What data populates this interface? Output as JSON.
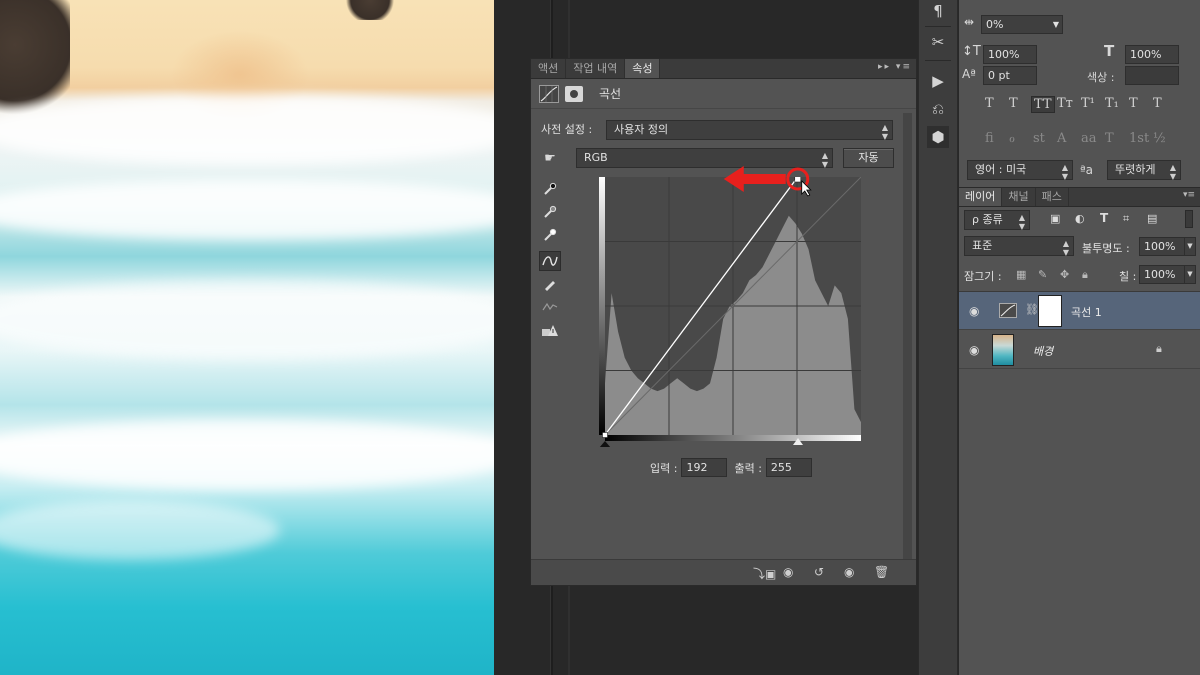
{
  "properties_panel": {
    "tabs": [
      "액션",
      "작업 내역",
      "속성"
    ],
    "active_tab": "속성",
    "tab_tools": "▸▸ ▾≡",
    "title": "곡선",
    "preset_label": "사전 설정 :",
    "preset_value": "사용자 정의",
    "channel_value": "RGB",
    "auto_button": "자동",
    "input_label": "입력 :",
    "input_value": "192",
    "output_label": "출력 :",
    "output_value": "255",
    "tool_icons": [
      "hand-adjust-icon",
      "eyedropper-black-icon",
      "eyedropper-gray-icon",
      "eyedropper-white-icon",
      "curve-point-icon",
      "pencil-icon",
      "smooth-icon",
      "clipping-warning-icon"
    ],
    "footer_icons": [
      "clip-to-layer-icon",
      "view-previous-icon",
      "reset-icon",
      "visibility-icon",
      "trash-icon"
    ],
    "curve": {
      "input_range": [
        0,
        255
      ],
      "output_range": [
        0,
        255
      ],
      "points": [
        [
          0,
          0
        ],
        [
          192,
          255
        ]
      ],
      "selected_point": [
        192,
        255
      ],
      "highlight_color": "#e8201d"
    }
  },
  "character_panel": {
    "tracking_value": "0%",
    "vertical_scale_value": "100%",
    "horizontal_scale_value": "100%",
    "baseline_value": "0 pt",
    "color_label": "색상 :",
    "style_glyphs": [
      "T",
      "T",
      "TT",
      "Tт",
      "T¹",
      "T₁",
      "T",
      "T"
    ],
    "opentype_glyphs": [
      "fi",
      "ℴ",
      "st",
      "A",
      "aa",
      "T",
      "1st",
      "½"
    ],
    "language_value": "영어 : 미국",
    "aa_label": "ªa",
    "antialias_value": "뚜렷하게"
  },
  "layers_panel": {
    "tabs": [
      "레이어",
      "채널",
      "패스"
    ],
    "active_tab": "레이어",
    "filter_value": "ρ 종류",
    "blend_mode": "표준",
    "opacity_label": "불투명도 :",
    "opacity_value": "100%",
    "lock_label": "잠그기 :",
    "fill_label": "칠 :",
    "fill_value": "100%",
    "layers": [
      {
        "name": "곡선 1",
        "selected": true,
        "type": "adjustment"
      },
      {
        "name": "배경",
        "selected": false,
        "type": "background",
        "locked": true
      }
    ]
  },
  "colors": {
    "panel": "#535353",
    "dark": "#282828",
    "selected_layer": "#56657a",
    "annotation_red": "#e8201d"
  }
}
